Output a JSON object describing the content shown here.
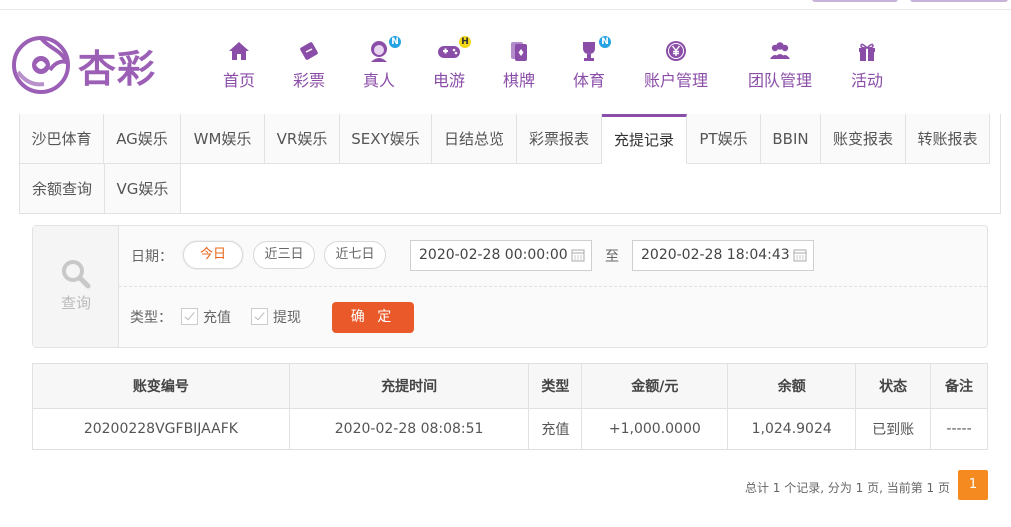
{
  "header": {
    "logo_text": "杏彩",
    "nav": [
      {
        "label": "首页",
        "icon": "home-icon",
        "badge": ""
      },
      {
        "label": "彩票",
        "icon": "lottery-ticket-icon",
        "badge": ""
      },
      {
        "label": "真人",
        "icon": "live-dealer-icon",
        "badge": "N"
      },
      {
        "label": "电游",
        "icon": "gamepad-icon",
        "badge": "H"
      },
      {
        "label": "棋牌",
        "icon": "playing-cards-icon",
        "badge": ""
      },
      {
        "label": "体育",
        "icon": "trophy-icon",
        "badge": "N"
      },
      {
        "label": "账户管理",
        "icon": "yen-coin-icon",
        "badge": ""
      },
      {
        "label": "团队管理",
        "icon": "team-icon",
        "badge": ""
      },
      {
        "label": "活动",
        "icon": "gift-icon",
        "badge": ""
      }
    ]
  },
  "tabs": {
    "row1": [
      "沙巴体育",
      "AG娱乐",
      "WM娱乐",
      "VR娱乐",
      "SEXY娱乐",
      "日结总览",
      "彩票报表",
      "充提记录",
      "PT娱乐",
      "BBIN",
      "账变报表",
      "转账报表"
    ],
    "row2": [
      "余额查询",
      "VG娱乐"
    ],
    "active": "充提记录"
  },
  "query": {
    "side_label": "查询",
    "date_label": "日期：",
    "quick": [
      "今日",
      "近三日",
      "近七日"
    ],
    "start": "2020-02-28 00:00:00",
    "to": "至",
    "end": "2020-02-28 18:04:43",
    "type_label": "类型：",
    "types": [
      "充值",
      "提现"
    ],
    "confirm": "确 定"
  },
  "table": {
    "headers": [
      "账变编号",
      "充提时间",
      "类型",
      "金额/元",
      "余额",
      "状态",
      "备注"
    ],
    "rows": [
      [
        "20200228VGFBIJAAFK",
        "2020-02-28 08:08:51",
        "充值",
        "+1,000.0000",
        "1,024.9024",
        "已到账",
        "-----"
      ]
    ]
  },
  "pager": {
    "summary": "总计 1 个记录, 分为 1 页, 当前第 1 页",
    "current": "1"
  },
  "colors": {
    "brand": "#8b4ea8",
    "accent": "#e9592a",
    "amount": "#d6000f",
    "status_ok": "#3b9e28",
    "page": "#f58a20"
  }
}
